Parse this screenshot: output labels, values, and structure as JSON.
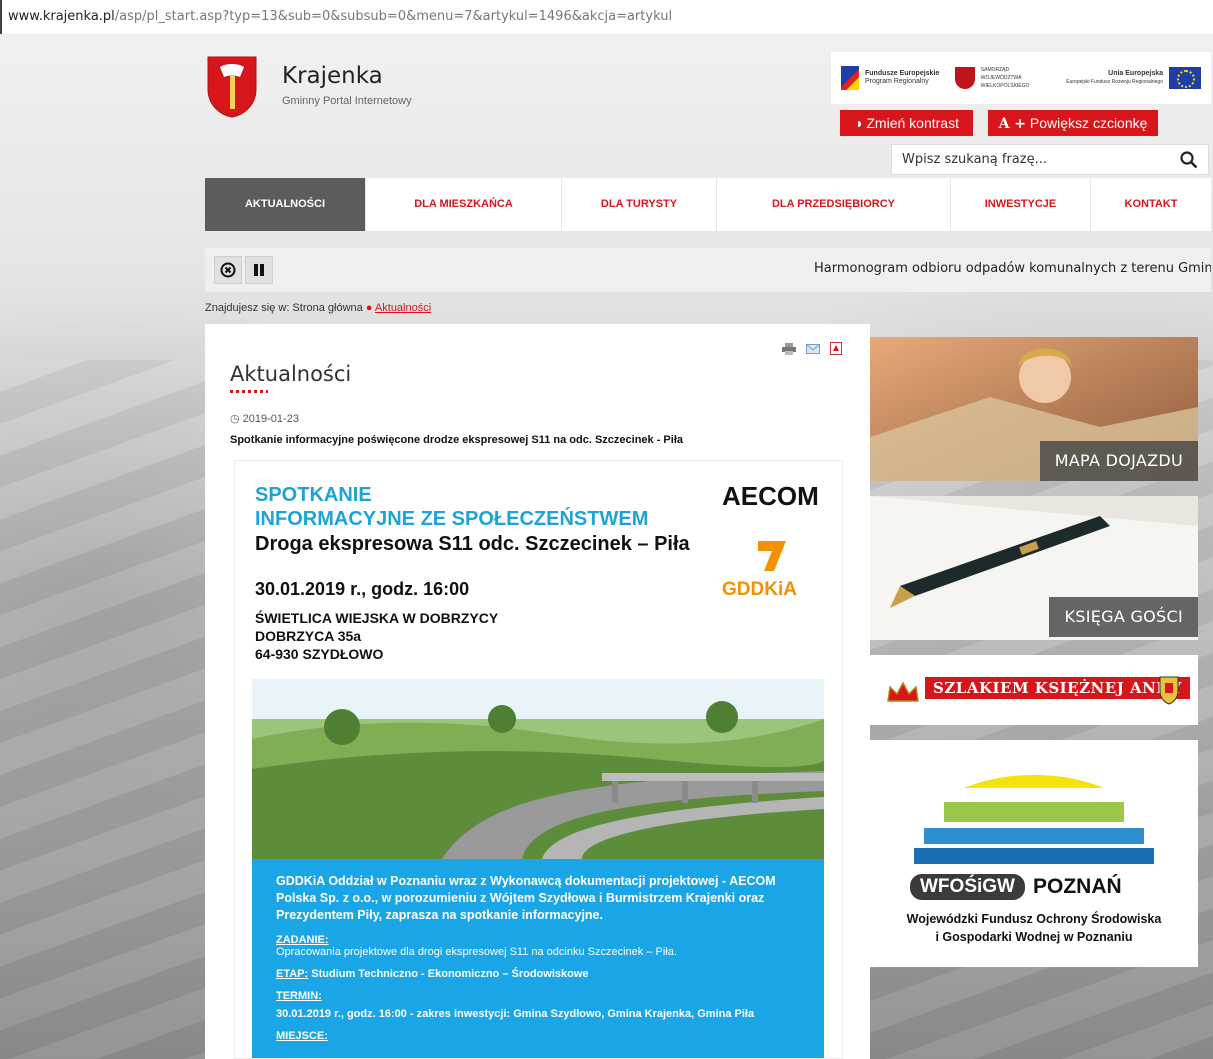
{
  "browser": {
    "url_host": "www.krajenka.pl",
    "url_path": "/asp/pl_start.asp?typ=13&sub=0&subsub=0&menu=7&artykul=1496&akcja=artykul"
  },
  "header": {
    "site_name": "Krajenka",
    "site_sub": "Gminny Portal Internetowy",
    "eu_logos": {
      "fundusze": "Fundusze Europejskie",
      "fundusze_sub": "Program Regionalny",
      "samorzad": "SAMORZĄD WOJEWÓDZTWA WIELKOPOLSKIEGO",
      "unia": "Unia Europejska",
      "unia_sub": "Europejski Fundusz Rozwoju Regionalnego"
    },
    "contrast_label": "Zmień kontrast",
    "font_label": "Powiększ czcionkę",
    "search_placeholder": "Wpisz szukaną frazę..."
  },
  "nav": {
    "items": [
      "AKTUALNOŚCI",
      "DLA MIESZKAŃCA",
      "DLA TURYSTY",
      "DLA PRZEDSIĘBIORCY",
      "INWESTYCJE",
      "KONTAKT"
    ],
    "active_index": 0
  },
  "ticker": {
    "text": "Harmonogram odbioru odpadów komunalnych z terenu Gminy i Mias"
  },
  "breadcrumb": {
    "prefix": "Znajdujesz się w: Strona główna",
    "current": "Aktualności"
  },
  "article": {
    "page_title": "Aktualności",
    "date": "2019-01-23",
    "lead": "Spotkanie informacyjne poświęcone drodze ekspresowej S11 na odc. Szczecinek - Piła"
  },
  "poster": {
    "heading_line1": "SPOTKANIE",
    "heading_line2": "INFORMACYJNE ZE SPOŁECZEŃSTWEM",
    "road": "Droga ekspresowa S11 odc. Szczecinek – Piła",
    "date": "30.01.2019 r., godz. 16:00",
    "addr1": "ŚWIETLICA WIEJSKA W DOBRZYCY",
    "addr2": "DOBRZYCA 35a",
    "addr3": "64-930 SZYDŁOWO",
    "aecom": "AECOM",
    "gddkia": "GDDKiA",
    "intro": "GDDKiA Oddział w Poznaniu wraz z Wykonawcą dokumentacji projektowej - AECOM Polska Sp. z o.o., w porozumieniu z Wójtem Szydłowa i Burmistrzem Krajenki oraz Prezydentem Piły, zaprasza na spotkanie informacyjne.",
    "zadanie_label": "ZADANIE:",
    "zadanie_text": "Opracowania projektowe dla drogi ekspresowej S11 na odcinku Szczecinek – Piła.",
    "etap_label": "ETAP:",
    "etap_text": "Studium Techniczno - Ekonomiczno – Środowiskowe",
    "termin_label": "TERMIN:",
    "termin_text": "30.01.2019 r., godz. 16:00 - zakres inwestycji: Gmina Szydłowo, Gmina Krajenka, Gmina Piła",
    "miejsce_label": "MIEJSCE:"
  },
  "sidebar": {
    "map_label": "MAPA DOJAZDU",
    "guestbook_label": "KSIĘGA GOŚCI",
    "szlak_label": "SZLAKIEM KSIĘŻNEJ ANNY",
    "wfos_badge": "WFOŚiGW",
    "wfos_city": "POZNAŃ",
    "wfos_full1": "Wojewódzki Fundusz Ochrony Środowiska",
    "wfos_full2": "i Gospodarki Wodnej w Poznaniu"
  },
  "colors": {
    "accent_red": "#d7161b",
    "poster_blue": "#1aa6e6",
    "nav_active": "#5c5c5c"
  }
}
